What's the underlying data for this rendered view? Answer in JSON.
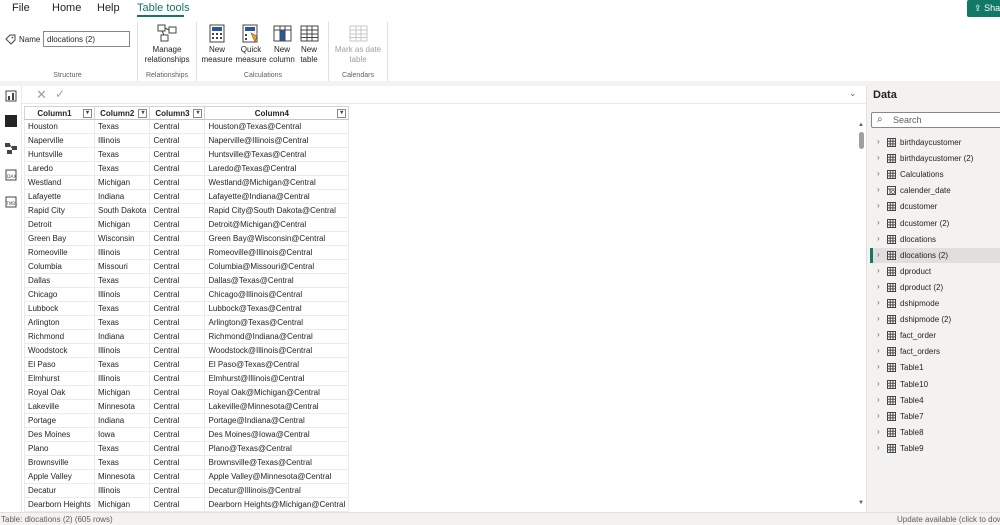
{
  "menu": {
    "file": "File",
    "home": "Home",
    "help": "Help",
    "table_tools": "Table tools",
    "share": "Sha"
  },
  "ribbon": {
    "name_label": "Name",
    "name_value": "dlocations (2)",
    "structure_label": "Structure",
    "manage_relationships": [
      "Manage",
      "relationships"
    ],
    "relationships_label": "Relationships",
    "new_measure": [
      "New",
      "measure"
    ],
    "quick_measure": [
      "Quick",
      "measure"
    ],
    "new_column": [
      "New",
      "column"
    ],
    "new_table": [
      "New",
      "table"
    ],
    "calculations_label": "Calculations",
    "mark_as_date_table": [
      "Mark as date",
      "table"
    ],
    "calendars_label": "Calendars"
  },
  "formula_bar": {
    "cancel": "✕",
    "commit": "✓",
    "expand": "⌄"
  },
  "table": {
    "columns": [
      "Column1",
      "Column2",
      "Column3",
      "Column4"
    ],
    "rows": [
      [
        "Houston",
        "Texas",
        "Central",
        "Houston@Texas@Central"
      ],
      [
        "Naperville",
        "Illinois",
        "Central",
        "Naperville@Illinois@Central"
      ],
      [
        "Huntsville",
        "Texas",
        "Central",
        "Huntsville@Texas@Central"
      ],
      [
        "Laredo",
        "Texas",
        "Central",
        "Laredo@Texas@Central"
      ],
      [
        "Westland",
        "Michigan",
        "Central",
        "Westland@Michigan@Central"
      ],
      [
        "Lafayette",
        "Indiana",
        "Central",
        "Lafayette@Indiana@Central"
      ],
      [
        "Rapid City",
        "South Dakota",
        "Central",
        "Rapid City@South Dakota@Central"
      ],
      [
        "Detroit",
        "Michigan",
        "Central",
        "Detroit@Michigan@Central"
      ],
      [
        "Green Bay",
        "Wisconsin",
        "Central",
        "Green Bay@Wisconsin@Central"
      ],
      [
        "Romeoville",
        "Illinois",
        "Central",
        "Romeoville@Illinois@Central"
      ],
      [
        "Columbia",
        "Missouri",
        "Central",
        "Columbia@Missouri@Central"
      ],
      [
        "Dallas",
        "Texas",
        "Central",
        "Dallas@Texas@Central"
      ],
      [
        "Chicago",
        "Illinois",
        "Central",
        "Chicago@Illinois@Central"
      ],
      [
        "Lubbock",
        "Texas",
        "Central",
        "Lubbock@Texas@Central"
      ],
      [
        "Arlington",
        "Texas",
        "Central",
        "Arlington@Texas@Central"
      ],
      [
        "Richmond",
        "Indiana",
        "Central",
        "Richmond@Indiana@Central"
      ],
      [
        "Woodstock",
        "Illinois",
        "Central",
        "Woodstock@Illinois@Central"
      ],
      [
        "El Paso",
        "Texas",
        "Central",
        "El Paso@Texas@Central"
      ],
      [
        "Elmhurst",
        "Illinois",
        "Central",
        "Elmhurst@Illinois@Central"
      ],
      [
        "Royal Oak",
        "Michigan",
        "Central",
        "Royal Oak@Michigan@Central"
      ],
      [
        "Lakeville",
        "Minnesota",
        "Central",
        "Lakeville@Minnesota@Central"
      ],
      [
        "Portage",
        "Indiana",
        "Central",
        "Portage@Indiana@Central"
      ],
      [
        "Des Moines",
        "Iowa",
        "Central",
        "Des Moines@Iowa@Central"
      ],
      [
        "Plano",
        "Texas",
        "Central",
        "Plano@Texas@Central"
      ],
      [
        "Brownsville",
        "Texas",
        "Central",
        "Brownsville@Texas@Central"
      ],
      [
        "Apple Valley",
        "Minnesota",
        "Central",
        "Apple Valley@Minnesota@Central"
      ],
      [
        "Decatur",
        "Illinois",
        "Central",
        "Decatur@Illinois@Central"
      ],
      [
        "Dearborn Heights",
        "Michigan",
        "Central",
        "Dearborn Heights@Michigan@Central"
      ]
    ]
  },
  "data_pane": {
    "title": "Data",
    "search_placeholder": "Search",
    "items": [
      {
        "label": "birthdaycustomer",
        "icon": "table-icon"
      },
      {
        "label": "birthdaycustomer (2)",
        "icon": "table-icon"
      },
      {
        "label": "Calculations",
        "icon": "table-icon"
      },
      {
        "label": "calender_date",
        "icon": "calendar-table-icon"
      },
      {
        "label": "dcustomer",
        "icon": "table-icon"
      },
      {
        "label": "dcustomer (2)",
        "icon": "table-icon"
      },
      {
        "label": "dlocations",
        "icon": "table-icon"
      },
      {
        "label": "dlocations (2)",
        "icon": "table-icon",
        "selected": true
      },
      {
        "label": "dproduct",
        "icon": "table-icon"
      },
      {
        "label": "dproduct (2)",
        "icon": "table-icon"
      },
      {
        "label": "dshipmode",
        "icon": "table-icon"
      },
      {
        "label": "dshipmode (2)",
        "icon": "table-icon"
      },
      {
        "label": "fact_order",
        "icon": "table-icon"
      },
      {
        "label": "fact_orders",
        "icon": "table-icon"
      },
      {
        "label": "Table1",
        "icon": "table-icon"
      },
      {
        "label": "Table10",
        "icon": "table-icon"
      },
      {
        "label": "Table4",
        "icon": "table-icon"
      },
      {
        "label": "Table7",
        "icon": "table-icon"
      },
      {
        "label": "Table8",
        "icon": "table-icon"
      },
      {
        "label": "Table9",
        "icon": "table-icon"
      }
    ]
  },
  "status": {
    "left": "Table: dlocations (2) (605 rows)",
    "right": "Update available (click to dow"
  },
  "colors": {
    "accent": "#117865",
    "pane_bg": "#f3f2f1",
    "selected_bg": "#e1dfdd"
  }
}
